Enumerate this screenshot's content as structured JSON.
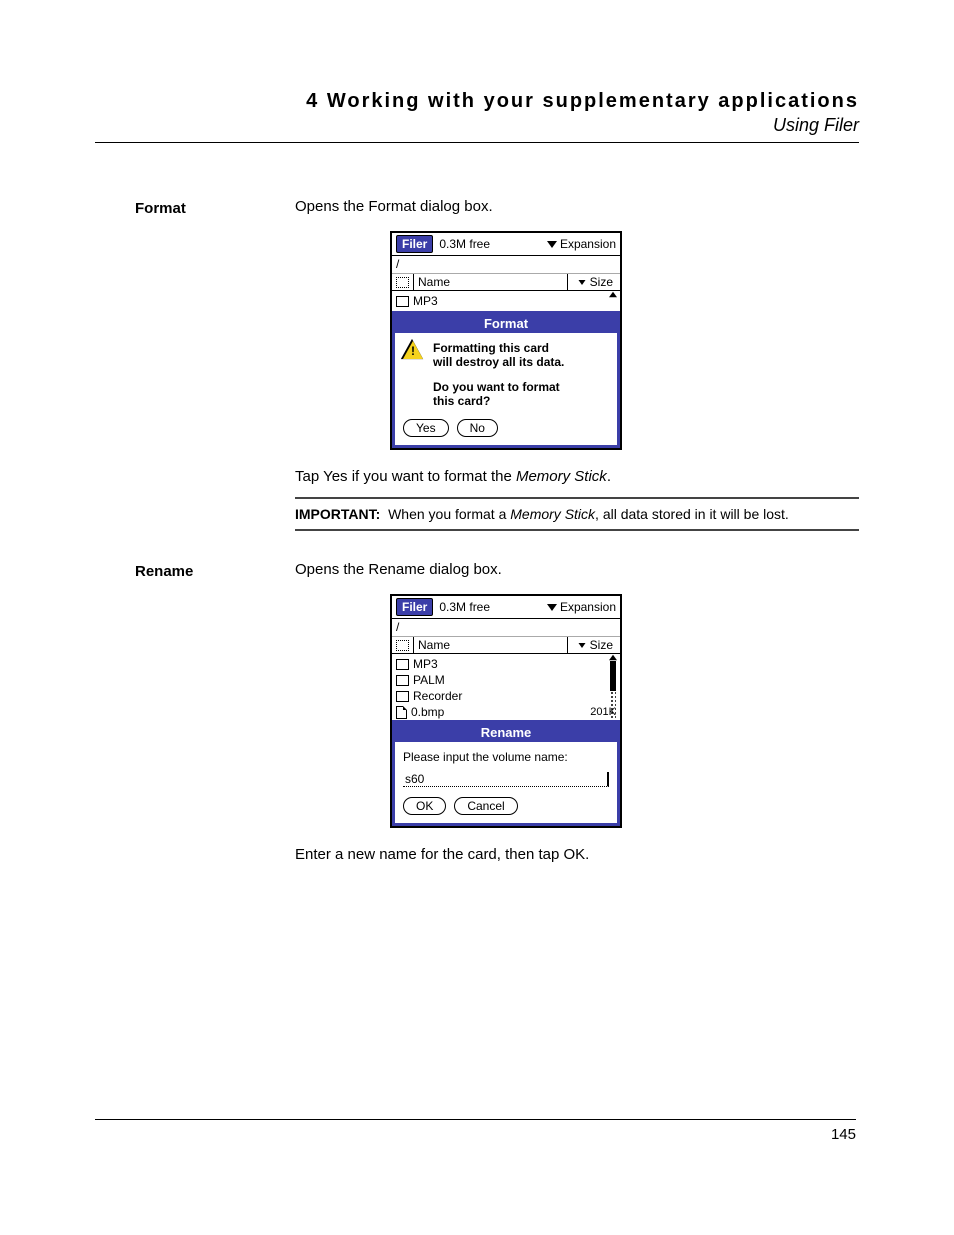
{
  "header": {
    "chapter": "4 Working with your supplementary applications",
    "section": "Using Filer"
  },
  "format_section": {
    "label": "Format",
    "desc": "Opens the Format dialog box.",
    "after_text_pre": "Tap Yes if you want to format the ",
    "after_text_em": "Memory Stick",
    "after_text_post": ".",
    "important_label": "IMPORTANT:",
    "important_pre": "When you format a ",
    "important_em": "Memory Stick",
    "important_post": ", all data stored in it will be lost."
  },
  "rename_section": {
    "label": "Rename",
    "desc": "Opens the Rename dialog box.",
    "after_text": "Enter a new name for the card, then tap OK."
  },
  "palm_common": {
    "app": "Filer",
    "free": "0.3M free",
    "expansion": "Expansion",
    "path": "/",
    "name_hdr": "Name",
    "size_hdr": "Size"
  },
  "format_screen": {
    "files": [
      "MP3"
    ],
    "dialog_title": "Format",
    "warn_line1": "Formatting this card",
    "warn_line2": "will destroy all its data.",
    "q_line1": "Do you want to format",
    "q_line2": "this card?",
    "yes": "Yes",
    "no": "No"
  },
  "rename_screen": {
    "files": [
      {
        "name": "MP3",
        "size": ""
      },
      {
        "name": "PALM",
        "size": ""
      },
      {
        "name": "Recorder",
        "size": ""
      },
      {
        "name": "0.bmp",
        "size": "201K"
      }
    ],
    "dialog_title": "Rename",
    "prompt": "Please input the volume name:",
    "input_value": "s60",
    "ok": "OK",
    "cancel": "Cancel"
  },
  "page_number": "145"
}
